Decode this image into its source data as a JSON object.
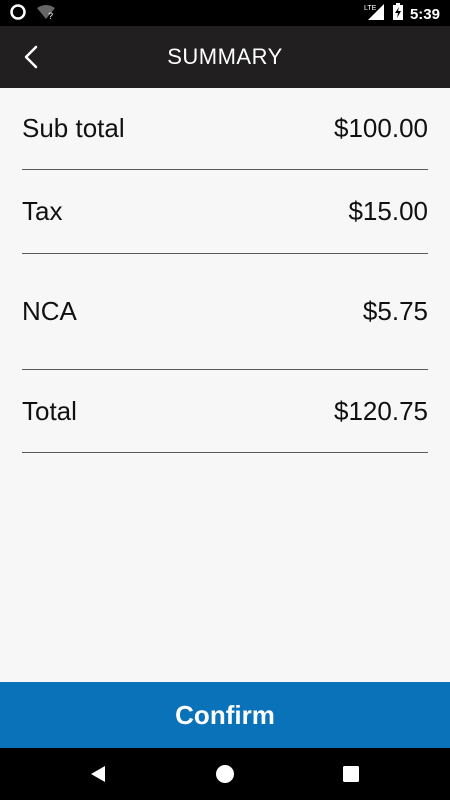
{
  "status_bar": {
    "time": "5:39",
    "network": "LTE",
    "icons": [
      "notification-icon",
      "wifi-icon",
      "signal-icon",
      "battery-icon"
    ]
  },
  "app_bar": {
    "title": "SUMMARY",
    "back_icon": "chevron-left-icon"
  },
  "summary": {
    "rows": [
      {
        "label": "Sub total",
        "value": "$100.00"
      },
      {
        "label": "Tax",
        "value": "$15.00"
      },
      {
        "label": "NCA",
        "value": "$5.75"
      },
      {
        "label": "Total",
        "value": "$120.75"
      }
    ]
  },
  "confirm_label": "Confirm",
  "colors": {
    "app_bar": "#211f1f",
    "confirm": "#0a72b9",
    "background": "#f7f7f7"
  },
  "nav_bar": {
    "icons": [
      "back-icon",
      "home-icon",
      "recents-icon"
    ]
  }
}
